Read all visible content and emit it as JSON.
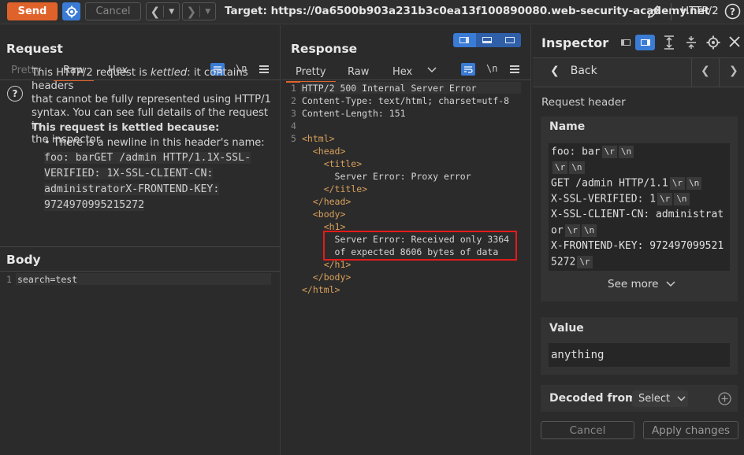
{
  "toolbar": {
    "send_label": "Send",
    "cancel_label": "Cancel",
    "target_label": "Target: https://0a6500b903a231b3c0ea13f100890080.web-security-academy.net",
    "protocol": "HTTP/2"
  },
  "request": {
    "title": "Request",
    "tabs": [
      "Pretty",
      "Raw",
      "Hex"
    ],
    "active_tab": "Raw",
    "newline_toggle": "\\n",
    "info_lines": [
      "This HTTP/2 request is kettled: it contains headers",
      "that cannot be fully represented using HTTP/1",
      "syntax. You can see full details of the request in",
      "the inspector."
    ],
    "info_prefix": "This HTTP/2 request is ",
    "info_italic": "kettled",
    "info_rest_1": ": it contains headers",
    "reason_heading": "This request is kettled because:",
    "reason_bullet": "• There is a newline in this header's name:",
    "reason_code": [
      "foo: barGET /admin HTTP/1.1X-SSL-",
      "VERIFIED: 1X-SSL-CLIENT-CN:",
      "administratorX-FRONTEND-KEY:",
      "9724970995215272"
    ],
    "body_title": "Body",
    "body_lines": [
      {
        "num": "1",
        "text": "search=test"
      }
    ]
  },
  "response": {
    "title": "Response",
    "tabs": [
      "Pretty",
      "Raw",
      "Hex"
    ],
    "active_tab": "Pretty",
    "newline_toggle": "\\n",
    "lines": [
      {
        "num": "1",
        "text": "HTTP/2 500 Internal Server Error"
      },
      {
        "num": "2",
        "text": "Content-Type: text/html; charset=utf-8"
      },
      {
        "num": "3",
        "text": "Content-Length: 151"
      },
      {
        "num": "4",
        "text": ""
      },
      {
        "num": "5",
        "text": "<html>"
      },
      {
        "num": "",
        "text": "  <head>"
      },
      {
        "num": "",
        "text": "    <title>"
      },
      {
        "num": "",
        "text": "      Server Error: Proxy error"
      },
      {
        "num": "",
        "text": "    </title>"
      },
      {
        "num": "",
        "text": "  </head>"
      },
      {
        "num": "",
        "text": "  <body>"
      },
      {
        "num": "",
        "text": "    <h1>"
      },
      {
        "num": "",
        "text": "      Server Error: Received only 3364"
      },
      {
        "num": "",
        "text": "      of expected 8606 bytes of data"
      },
      {
        "num": "",
        "text": "    </h1>"
      },
      {
        "num": "",
        "text": "  </body>"
      },
      {
        "num": "",
        "text": "</html>"
      }
    ]
  },
  "inspector": {
    "title": "Inspector",
    "back_label": "Back",
    "section_label": "Request header",
    "name_label": "Name",
    "name_lines": [
      {
        "text": "foo: bar",
        "escapes": [
          "\\r",
          "\\n"
        ]
      },
      {
        "text": "",
        "escapes": [
          "\\r",
          "\\n"
        ]
      },
      {
        "text": "GET /admin HTTP/1.1",
        "escapes": [
          "\\r",
          "\\n"
        ]
      },
      {
        "text": "X-SSL-VERIFIED: 1",
        "escapes": [
          "\\r",
          "\\n"
        ]
      },
      {
        "text": "X-SSL-CLIENT-CN: administrat",
        "escapes": []
      },
      {
        "text": "or",
        "escapes": [
          "\\r",
          "\\n"
        ]
      },
      {
        "text": "X-FRONTEND-KEY: 972497099521",
        "escapes": []
      },
      {
        "text": "5272",
        "escapes": [
          "\\r"
        ]
      }
    ],
    "see_more": "See more",
    "value_label": "Value",
    "value": "anything",
    "decoded_label": "Decoded from:",
    "decoded_select": "Select",
    "cancel_label": "Cancel",
    "apply_label": "Apply changes"
  },
  "colors": {
    "accent": "#e0622b",
    "blue": "#3a7bd5",
    "highlight": "#e31b1b"
  }
}
